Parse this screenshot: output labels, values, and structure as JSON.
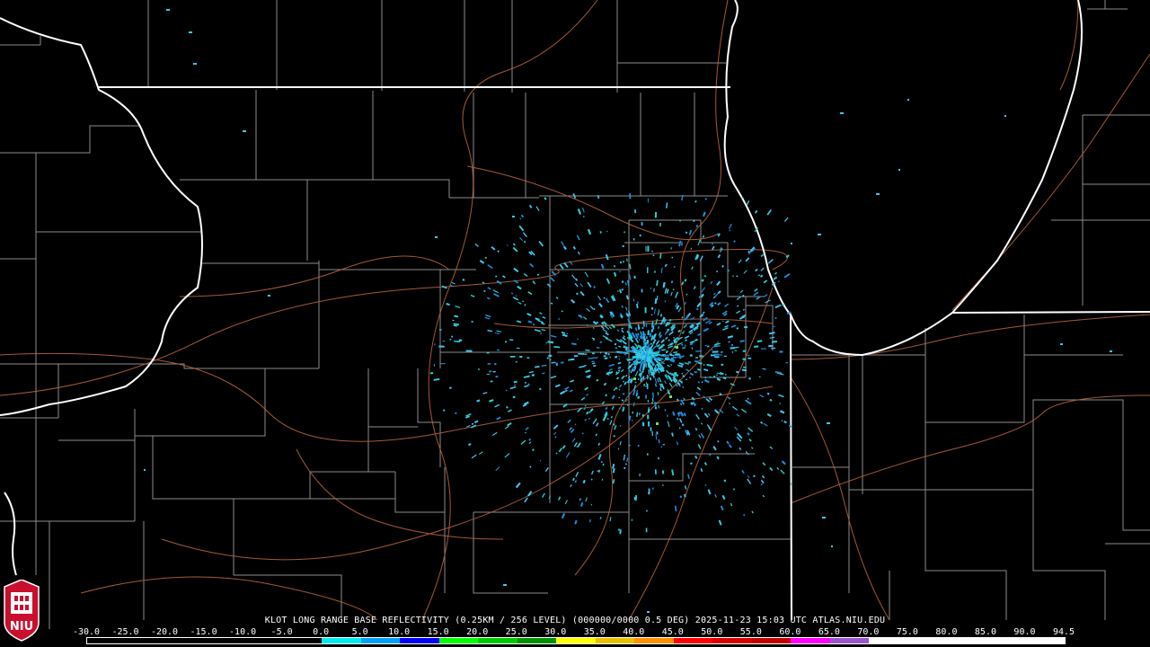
{
  "product_title": "KLOT LONG RANGE BASE REFLECTIVITY (0.25KM / 256 LEVEL) (000000/0000 0.5 DEG)",
  "timestamp": "2025-11-23 15:03 UTC",
  "source": "ATLAS.NIU.EDU",
  "logo_text": "NIU",
  "colorbar": {
    "labels": [
      "-30.0",
      "-25.0",
      "-20.0",
      "-15.0",
      "-10.0",
      "-5.0",
      "0.0",
      "5.0",
      "10.0",
      "15.0",
      "20.0",
      "25.0",
      "30.0",
      "35.0",
      "40.0",
      "45.0",
      "50.0",
      "55.0",
      "60.0",
      "65.0",
      "70.0",
      "75.0",
      "80.0",
      "85.0",
      "90.0",
      "94.5"
    ],
    "colors": [
      "#000000",
      "#000000",
      "#000000",
      "#000000",
      "#000000",
      "#000000",
      "#00ecec",
      "#01a0f6",
      "#0000f6",
      "#00ff00",
      "#00c800",
      "#009000",
      "#ffff00",
      "#e7c000",
      "#ff9000",
      "#ff0000",
      "#d60000",
      "#c00000",
      "#ff00ff",
      "#9955c9",
      "#ffffff",
      "#ffffff",
      "#ffffff",
      "#ffffff",
      "#ffffff"
    ]
  },
  "colors": {
    "background": "#000000",
    "state_border": "#ffffff",
    "county_border": "#8c8c8c",
    "highway": "#b4643c",
    "echo_light": "#3cc8f0",
    "echo_mid": "#1e8cdc"
  }
}
